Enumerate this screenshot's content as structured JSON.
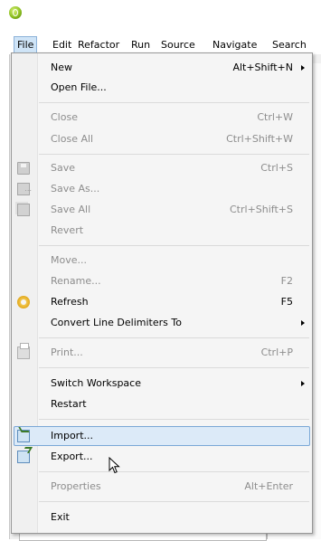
{
  "window": {
    "app_icon": "eclipse-icon"
  },
  "menubar": {
    "items": [
      {
        "label": "File"
      },
      {
        "label": "Edit"
      },
      {
        "label": "Refactor"
      },
      {
        "label": "Run"
      },
      {
        "label": "Source"
      },
      {
        "label": "Navigate"
      },
      {
        "label": "Search"
      }
    ]
  },
  "file_menu": {
    "items": [
      {
        "label": "New",
        "accelerator": "Alt+Shift+N",
        "submenu": true
      },
      {
        "label": "Open File..."
      },
      {
        "label": "Close",
        "accelerator": "Ctrl+W",
        "disabled": true
      },
      {
        "label": "Close All",
        "accelerator": "Ctrl+Shift+W",
        "disabled": true
      },
      {
        "label": "Save",
        "accelerator": "Ctrl+S",
        "disabled": true,
        "icon": "save-icon"
      },
      {
        "label": "Save As...",
        "disabled": true,
        "icon": "save-as-icon"
      },
      {
        "label": "Save All",
        "accelerator": "Ctrl+Shift+S",
        "disabled": true,
        "icon": "save-all-icon"
      },
      {
        "label": "Revert",
        "disabled": true
      },
      {
        "label": "Move...",
        "disabled": true
      },
      {
        "label": "Rename...",
        "accelerator": "F2",
        "disabled": true
      },
      {
        "label": "Refresh",
        "accelerator": "F5",
        "icon": "refresh-icon"
      },
      {
        "label": "Convert Line Delimiters To",
        "submenu": true
      },
      {
        "label": "Print...",
        "accelerator": "Ctrl+P",
        "disabled": true,
        "icon": "print-icon"
      },
      {
        "label": "Switch Workspace",
        "submenu": true
      },
      {
        "label": "Restart"
      },
      {
        "label": "Import...",
        "icon": "import-icon",
        "selected": true
      },
      {
        "label": "Export...",
        "icon": "export-icon"
      },
      {
        "label": "Properties",
        "accelerator": "Alt+Enter",
        "disabled": true
      },
      {
        "label": "Exit"
      }
    ]
  },
  "colors": {
    "highlight": "#dceaf8",
    "highlight_border": "#7aa7d6",
    "disabled_text": "#8d8d8d"
  }
}
